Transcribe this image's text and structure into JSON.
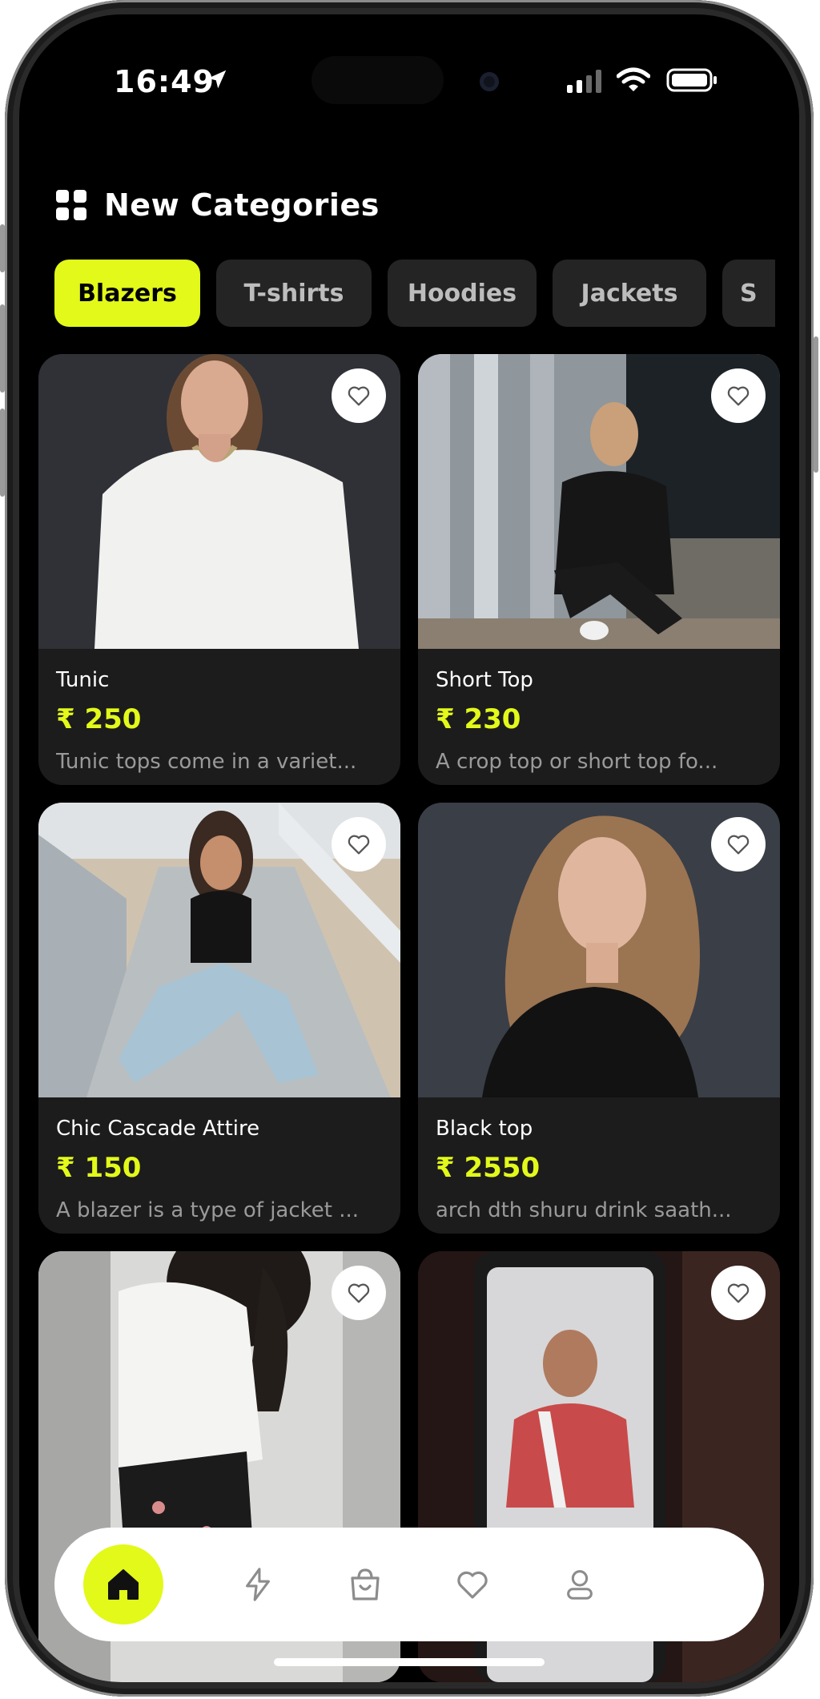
{
  "status_bar": {
    "time": "16:49"
  },
  "header": {
    "title": "New Categories",
    "icon": "grid-icon"
  },
  "tabs": [
    {
      "label": "Blazers",
      "active": true
    },
    {
      "label": "T-shirts",
      "active": false
    },
    {
      "label": "Hoodies",
      "active": false
    },
    {
      "label": "Jackets",
      "active": false
    },
    {
      "label": "S",
      "active": false
    }
  ],
  "products": [
    {
      "name": "Tunic",
      "price": "₹ 250",
      "description": "Tunic tops come in a variet..."
    },
    {
      "name": "Short Top",
      "price": "₹ 230",
      "description": "A crop top or short top fo..."
    },
    {
      "name": "Chic Cascade Attire",
      "price": "₹ 150",
      "description": "A blazer is a type of jacket ..."
    },
    {
      "name": "Black top",
      "price": "₹ 2550",
      "description": "arch dth shuru drink saath..."
    },
    {
      "name": "",
      "price": "",
      "description": ""
    },
    {
      "name": "",
      "price": "",
      "description": ""
    }
  ],
  "bottom_nav": [
    {
      "icon": "home-icon",
      "active": true
    },
    {
      "icon": "lightning-icon",
      "active": false
    },
    {
      "icon": "shopping-bag-icon",
      "active": false
    },
    {
      "icon": "heart-icon",
      "active": false
    },
    {
      "icon": "profile-icon",
      "active": false
    }
  ],
  "colors": {
    "accent": "#e2f91a",
    "background": "#000000",
    "card": "#1c1c1c",
    "nav": "#ffffff"
  }
}
